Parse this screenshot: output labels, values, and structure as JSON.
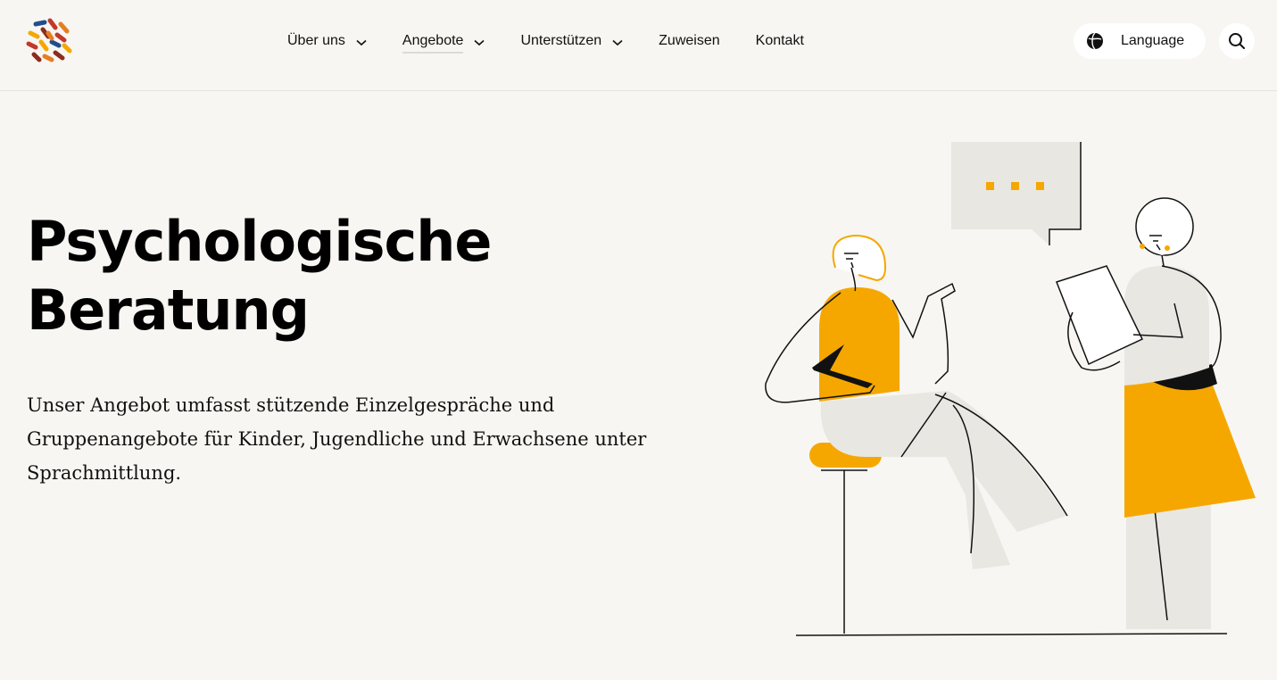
{
  "header": {
    "logo_name": "organization-logo",
    "nav": [
      {
        "label": "Über uns",
        "has_dropdown": true,
        "active": false
      },
      {
        "label": "Angebote",
        "has_dropdown": true,
        "active": true
      },
      {
        "label": "Unterstützen",
        "has_dropdown": true,
        "active": false
      },
      {
        "label": "Zuweisen",
        "has_dropdown": false,
        "active": false
      },
      {
        "label": "Kontakt",
        "has_dropdown": false,
        "active": false
      }
    ],
    "language_label": "Language",
    "language_icon": "globe-icon",
    "search_icon": "search-icon"
  },
  "hero": {
    "title": "Psychologische Beratung",
    "text": "Unser Angebot umfasst stützende Einzelgespräche und Gruppenangebote für Kinder, Jugendliche und Erwachsene unter Sprachmittlung."
  },
  "colors": {
    "background": "#f7f6f2",
    "accent": "#f5a700",
    "illustration_gray": "#e8e7e2",
    "text": "#111111"
  }
}
